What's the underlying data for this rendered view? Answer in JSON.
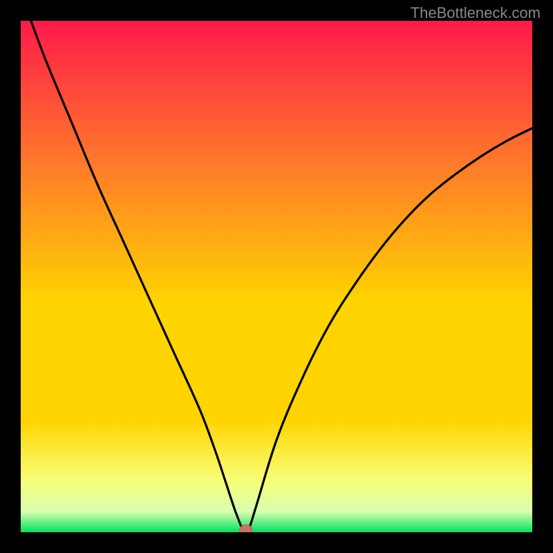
{
  "watermark": "TheBottleneck.com",
  "chart_data": {
    "type": "line",
    "title": "",
    "xlabel": "",
    "ylabel": "",
    "xlim": [
      0,
      100
    ],
    "ylim": [
      0,
      100
    ],
    "gradient_colors": {
      "top": "#ff1a4a",
      "upper_mid": "#ff7a2a",
      "mid": "#ffd400",
      "lower_mid": "#f8ff7a",
      "near_bottom": "#d8ffb0",
      "bottom": "#00e060"
    },
    "series": [
      {
        "name": "curve",
        "x": [
          2,
          5,
          10,
          15,
          20,
          25,
          30,
          35,
          38,
          40,
          42,
          43.5,
          44.5,
          46,
          50,
          55,
          60,
          65,
          70,
          75,
          80,
          85,
          90,
          95,
          100
        ],
        "y": [
          100,
          92,
          80,
          68,
          57,
          46,
          35,
          24,
          16,
          10,
          4,
          0.5,
          0.5,
          5,
          18,
          30,
          40,
          48,
          55,
          61,
          66,
          70,
          73.5,
          76.5,
          79
        ]
      }
    ],
    "marker": {
      "x": 44,
      "y": 0.5,
      "color": "#cc6f6b"
    },
    "frame_color": "#000000",
    "curve_color": "#000000"
  }
}
